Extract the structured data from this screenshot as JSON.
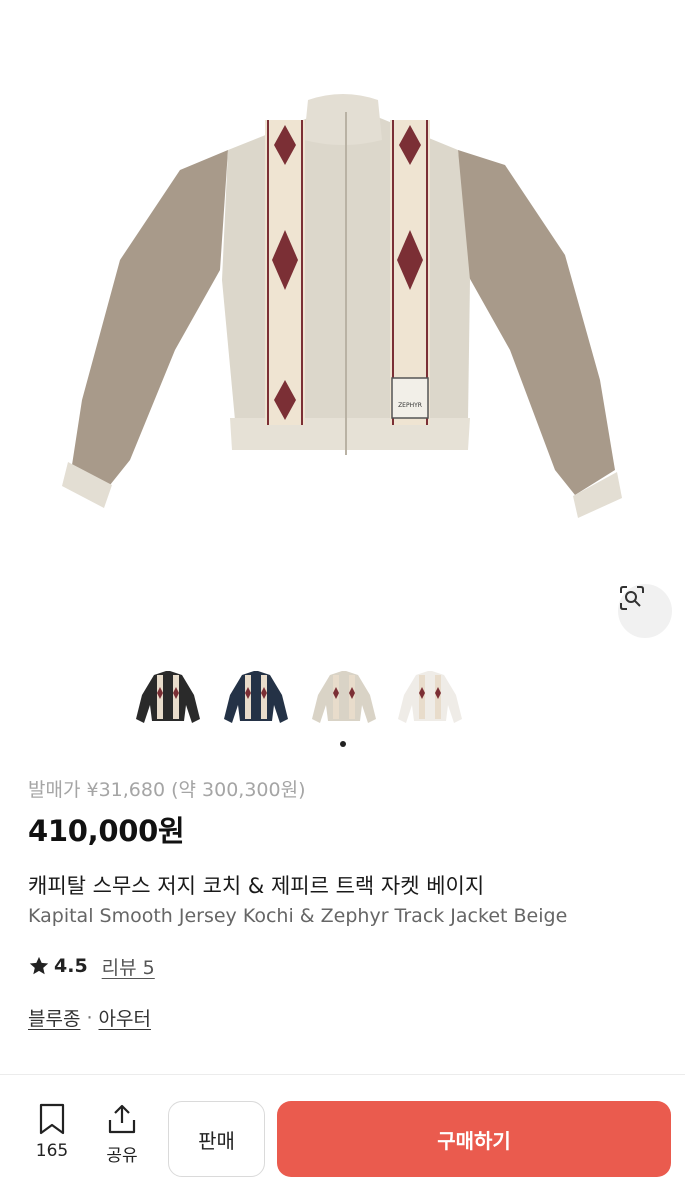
{
  "product": {
    "release_price": "발매가 ¥31,680 (약 300,300원)",
    "price": "410,000원",
    "title_ko": "캐피탈 스무스 저지 코치 & 제피르 트랙 자켓 베이지",
    "title_en": "Kapital Smooth Jersey Kochi & Zephyr Track Jacket Beige",
    "rating": "4.5",
    "review_label": "리뷰 5",
    "categories": [
      "블루종",
      "아우터"
    ],
    "category_separator": "·",
    "patch_text": "ZEPHYR"
  },
  "gallery": {
    "thumbnails": [
      {
        "name": "black",
        "color": "#2a2a2a"
      },
      {
        "name": "navy",
        "color": "#243246"
      },
      {
        "name": "beige",
        "color": "#d9d3c6"
      },
      {
        "name": "white",
        "color": "#efece7"
      }
    ],
    "lens_icon": "lens-search-icon"
  },
  "bottom_bar": {
    "bookmark_count": "165",
    "share_label": "공유",
    "sell_label": "판매",
    "buy_label": "구매하기"
  },
  "colors": {
    "accent": "#ea5b4e",
    "body": "#dcd7cb",
    "sleeve": "#a89a8a",
    "pattern": "#7b2f35"
  }
}
